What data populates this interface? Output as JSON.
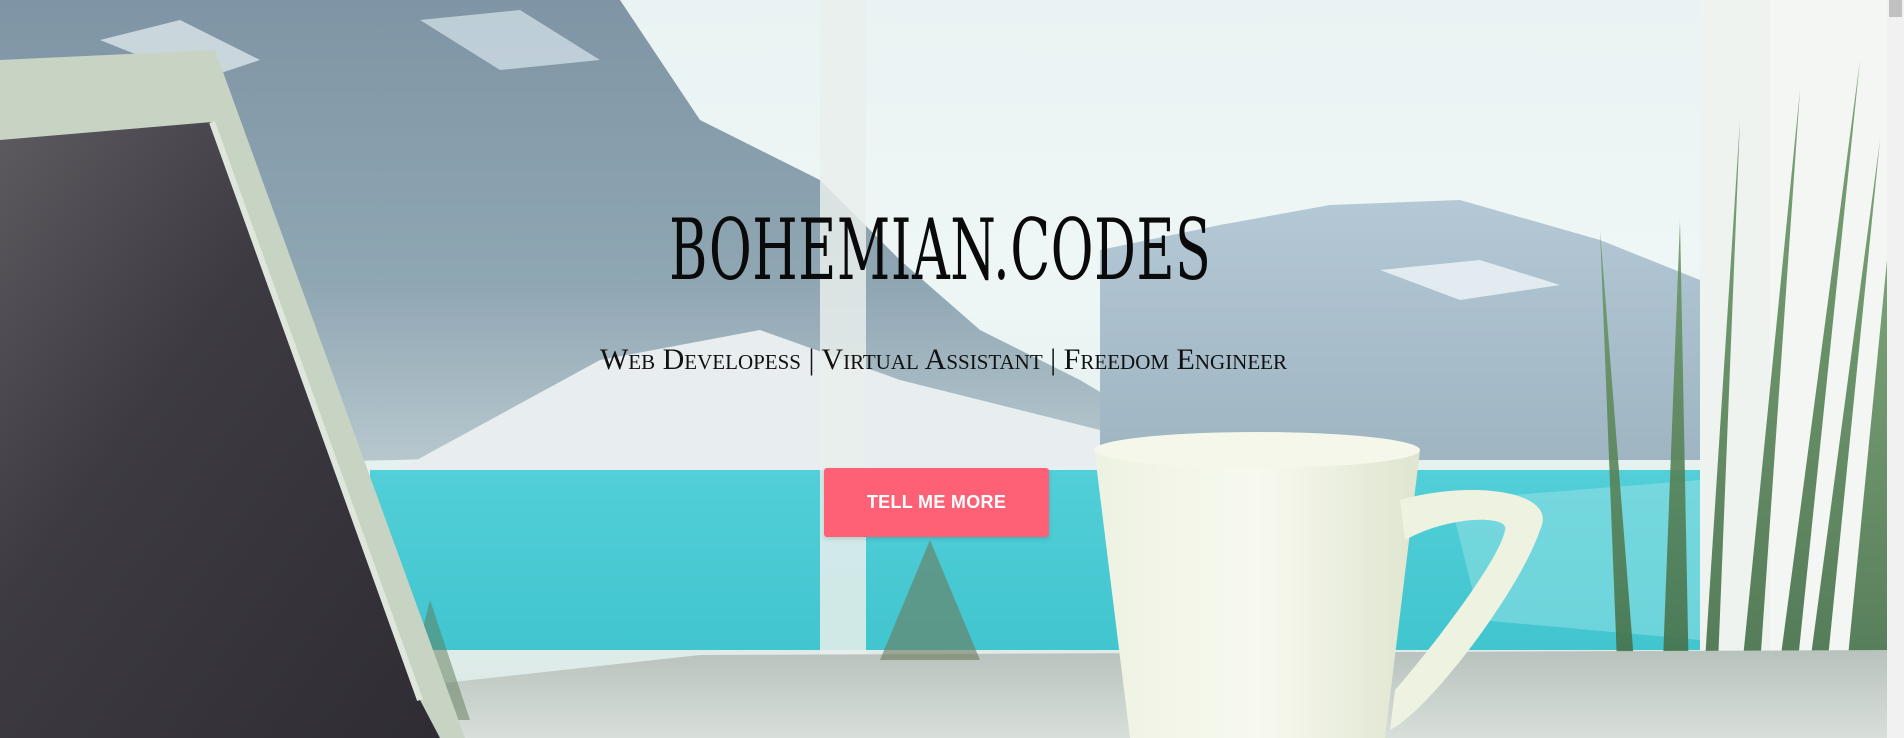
{
  "hero": {
    "title": "BOHEMIAN.CODES",
    "subtitle": "Web Developess | Virtual Assistant | Freedom Engineer",
    "cta_label": "TELL ME MORE"
  },
  "colors": {
    "cta_background": "#fe6175",
    "cta_text": "#ffffff",
    "title_text": "#0a0a0a"
  }
}
